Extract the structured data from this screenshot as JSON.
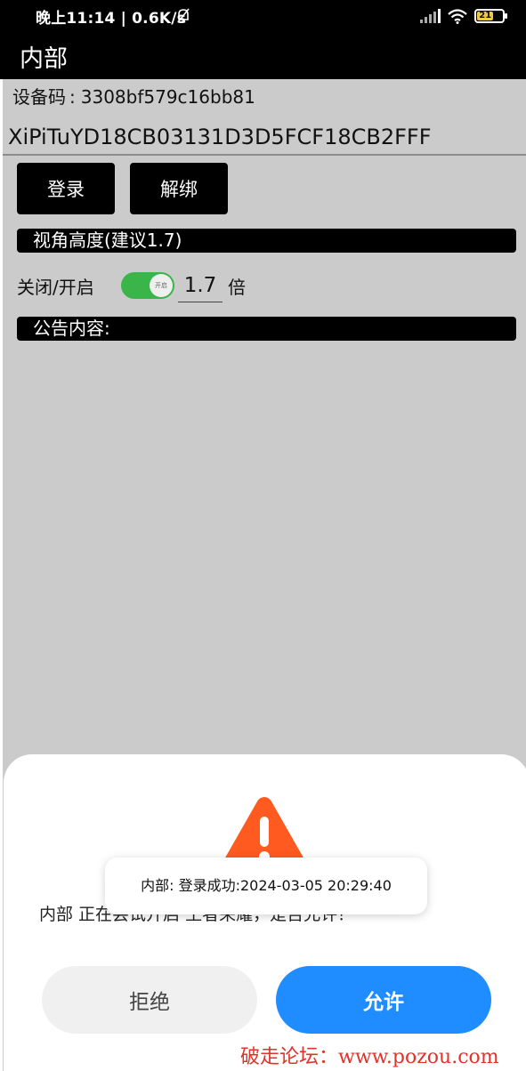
{
  "status_bar": {
    "time": "晚上11:14 | 0.6K/s",
    "battery_level": "21",
    "battery_color": "#f1c84a"
  },
  "app_bar": {
    "title": "内部"
  },
  "device": {
    "label": "设备码",
    "separator": ":",
    "value": "3308bf579c16bb81"
  },
  "key_input": {
    "value": "XiPiTuYD18CB03131D3D5FCF18CB2FFF"
  },
  "buttons": {
    "login": "登录",
    "unbind": "解绑"
  },
  "view_height": {
    "section_title": "视角高度(建议1.7)",
    "toggle_label": "关闭/开启",
    "toggle_state": "on",
    "toggle_knob_text": "开启",
    "toggle_color": "#39b54a",
    "value": "1.7",
    "unit": "倍"
  },
  "notice": {
    "section_title": "公告内容:"
  },
  "dialog": {
    "message": "内部 正在尝试开启 王者荣耀，是否允许？",
    "reject": "拒绝",
    "allow": "允许",
    "allow_color": "#1f8cff",
    "warning_color": "#ff5a1f"
  },
  "toast": {
    "text": "内部: 登录成功:2024-03-05 20:29:40"
  },
  "watermark": {
    "text": "破走论坛：www.pozou.com"
  }
}
